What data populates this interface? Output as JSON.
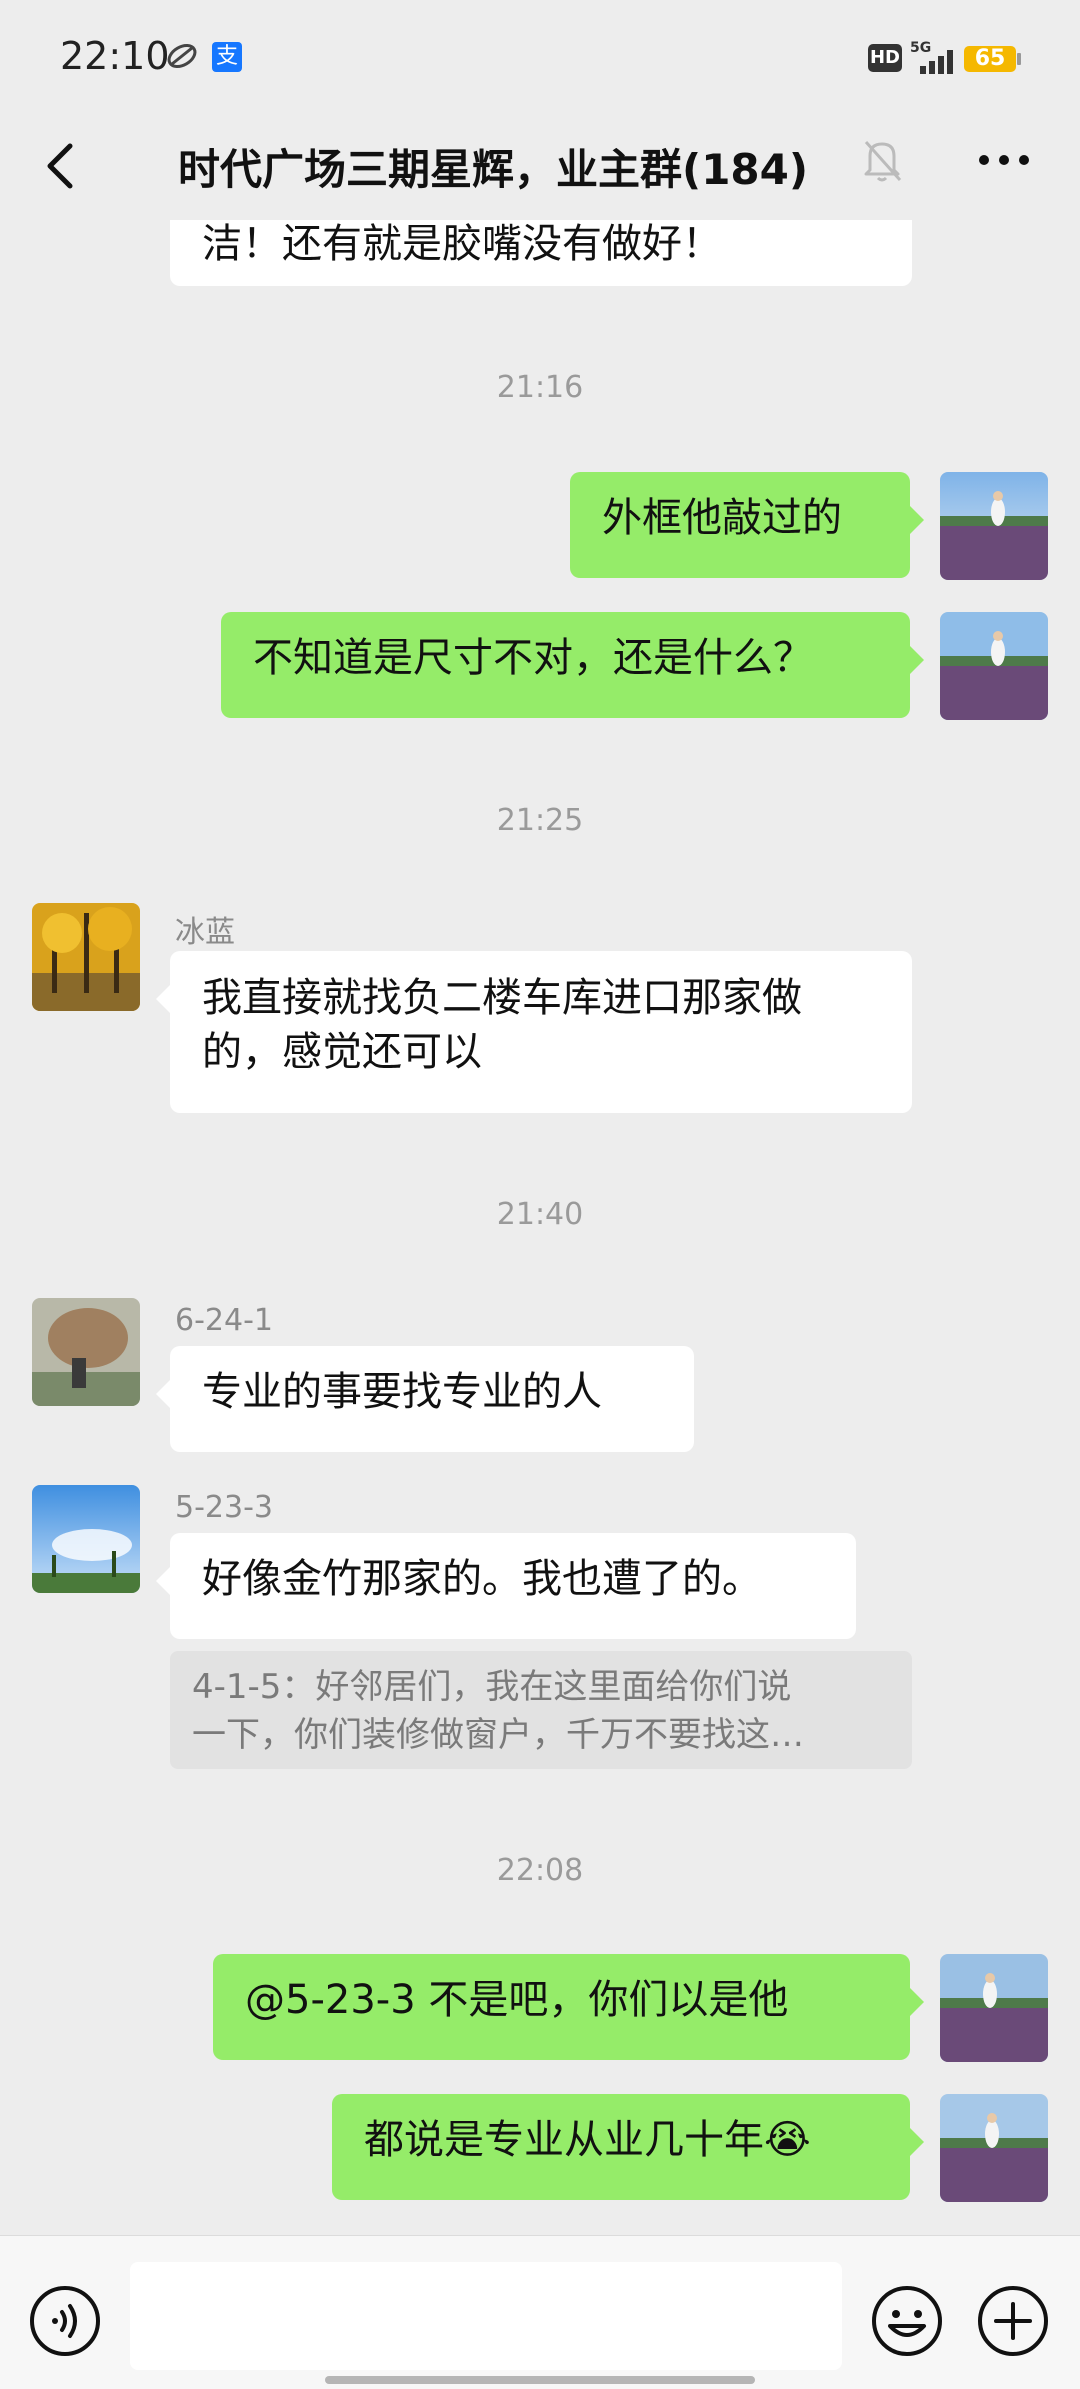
{
  "status_bar": {
    "time": "22:10",
    "alipay": "支",
    "hd": "HD",
    "network": "5G",
    "battery": "65"
  },
  "header": {
    "title": "时代广场三期星辉，业主群(184)"
  },
  "messages": {
    "m0": "洁！还有就是胶嘴没有做好！",
    "ts1": "21:16",
    "m1": "外框他敲过的",
    "m2": "不知道是尺寸不对，还是什么？",
    "ts2": "21:25",
    "m3_sender": "冰蓝",
    "m3_line1": "我直接就找负二楼车库进口那家做",
    "m3_line2": "的，感觉还可以",
    "ts3": "21:40",
    "m4_sender": "6-24-1",
    "m4": "专业的事要找专业的人",
    "m5_sender": "5-23-3",
    "m5": "好像金竹那家的。我也遭了的。",
    "m5_quote_line1": "4-1-5：好邻居们，我在这里面给你们说",
    "m5_quote_line2": "一下，你们装修做窗户，千万不要找这…",
    "ts4": "22:08",
    "m6": "@5-23-3 不是吧，你们以是他",
    "m7": "都说是专业从业几十年😭"
  },
  "colors": {
    "outgoing_bubble": "#95ec69",
    "incoming_bubble": "#ffffff",
    "background": "#ededed"
  },
  "icons": [
    "back-arrow-icon",
    "mute-bell-icon",
    "more-icon",
    "voice-icon",
    "emoji-icon",
    "plus-icon"
  ]
}
